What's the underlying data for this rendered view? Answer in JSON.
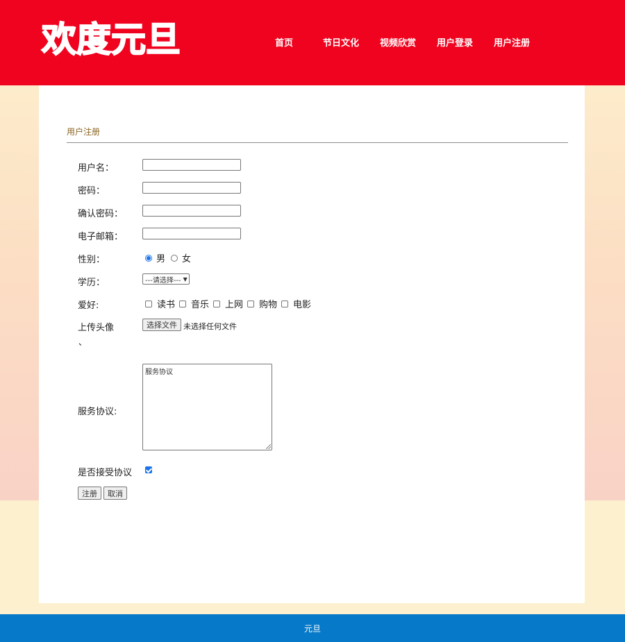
{
  "header": {
    "logo_text": "欢度元旦",
    "background_color": "#f0031f",
    "nav": [
      {
        "label": "首页"
      },
      {
        "label": "节日文化"
      },
      {
        "label": "视频欣赏"
      },
      {
        "label": "用户登录"
      },
      {
        "label": "用户注册"
      }
    ]
  },
  "form": {
    "section_title": "用户注册",
    "fields": {
      "username_label": "用户名：",
      "username_value": "",
      "password_label": "密码：",
      "password_value": "",
      "confirm_label": "确认密码：",
      "confirm_value": "",
      "email_label": "电子邮箱：",
      "email_value": "",
      "gender_label": "性别：",
      "gender_options": [
        "男",
        "女"
      ],
      "gender_selected": "男",
      "education_label": "学历：",
      "education_selected": "---请选择---",
      "hobby_label": "爱好:",
      "hobby_options": [
        "读书",
        "音乐",
        "上网",
        "购物",
        "电影"
      ],
      "avatar_label": "上传头像",
      "file_button": "选择文件",
      "file_status": "未选择任何文件",
      "stray_mark": "、",
      "agreement_label": "服务协议:",
      "agreement_text": "服务协议",
      "accept_label": "是否接受协议",
      "accept_checked": true
    },
    "buttons": {
      "submit": "注册",
      "cancel": "取消"
    }
  },
  "footer": {
    "text": "元旦",
    "background_color": "#0779c9"
  }
}
